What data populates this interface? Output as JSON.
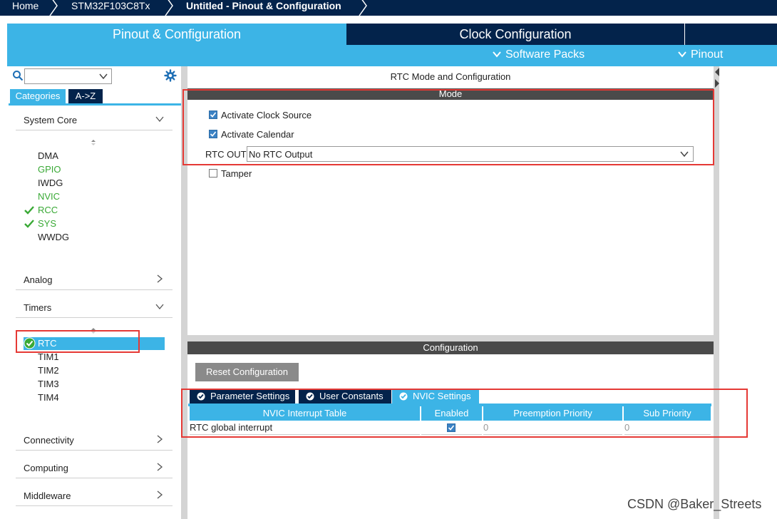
{
  "breadcrumb": {
    "home": "Home",
    "chip": "STM32F103C8Tx",
    "page": "Untitled - Pinout & Configuration"
  },
  "tabs": {
    "pinout": "Pinout & Configuration",
    "clock": "Clock Configuration"
  },
  "submenu": {
    "software_packs": "Software Packs",
    "pinout": "Pinout"
  },
  "left": {
    "search_value": "",
    "cat_tabs": [
      "Categories",
      "A->Z"
    ],
    "sections": {
      "system_core": "System Core",
      "analog": "Analog",
      "timers": "Timers",
      "connectivity": "Connectivity",
      "computing": "Computing",
      "middleware": "Middleware"
    },
    "system_core_items": [
      "DMA",
      "GPIO",
      "IWDG",
      "NVIC",
      "RCC",
      "SYS",
      "WWDG"
    ],
    "timer_items": [
      "RTC",
      "TIM1",
      "TIM2",
      "TIM3",
      "TIM4"
    ]
  },
  "mode_panel": {
    "title": "RTC Mode and Configuration",
    "mode_header": "Mode",
    "activate_clock_source": "Activate Clock Source",
    "activate_calendar": "Activate Calendar",
    "rtc_out_label": "RTC OUT",
    "rtc_out_value": "No RTC Output",
    "tamper": "Tamper"
  },
  "config_panel": {
    "header": "Configuration",
    "reset_button": "Reset Configuration",
    "tabs": [
      "Parameter Settings",
      "User Constants",
      "NVIC Settings"
    ],
    "table_headers": [
      "NVIC Interrupt Table",
      "Enabled",
      "Preemption Priority",
      "Sub Priority"
    ],
    "row": {
      "name": "RTC global interrupt",
      "preemption": "0",
      "sub": "0"
    }
  },
  "watermark": "CSDN @Baker_Streets",
  "colors": {
    "navy": "#03234b",
    "accent": "#3cb4e6",
    "enabled_green": "#39a935",
    "annotation_red": "#e53935"
  }
}
